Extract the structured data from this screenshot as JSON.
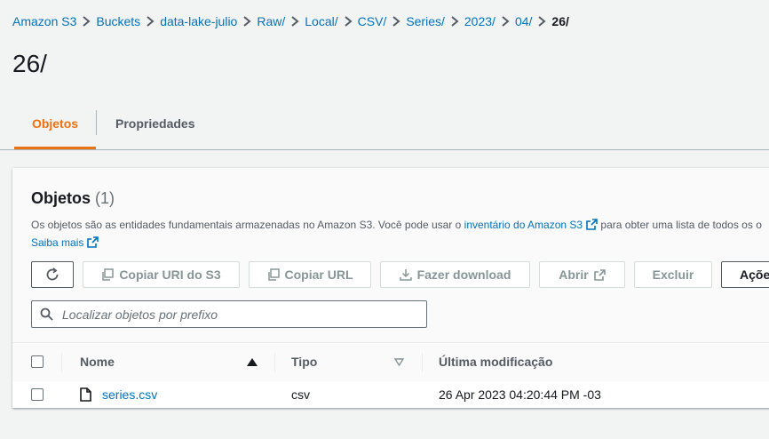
{
  "breadcrumb": [
    "Amazon S3",
    "Buckets",
    "data-lake-julio",
    "Raw/",
    "Local/",
    "CSV/",
    "Series/",
    "2023/",
    "04/",
    "26/"
  ],
  "page_title": "26/",
  "tabs": {
    "active": "Objetos",
    "inactive": "Propriedades"
  },
  "panel": {
    "title": "Objetos",
    "count": "(1)",
    "desc_prefix": "Os objetos são as entidades fundamentais armazenadas no Amazon S3. Você pode usar o",
    "desc_link": "inventário do Amazon S3",
    "desc_suffix": "para obter uma lista de todos os o",
    "learn_more": "Saiba mais"
  },
  "toolbar": {
    "copy_uri": "Copiar URI do S3",
    "copy_url": "Copiar URL",
    "download": "Fazer download",
    "open": "Abrir",
    "delete": "Excluir",
    "actions": "Açõe"
  },
  "search": {
    "placeholder": "Localizar objetos por prefixo"
  },
  "table": {
    "columns": {
      "name": "Nome",
      "type": "Tipo",
      "modified": "Última modificação"
    },
    "rows": [
      {
        "name": "series.csv",
        "type": "csv",
        "modified": "26 Apr 2023 04:20:44 PM -03"
      }
    ]
  },
  "colors": {
    "link": "#0073bb",
    "accent": "#ec7211",
    "disabled": "#879596",
    "text": "#16191f"
  }
}
